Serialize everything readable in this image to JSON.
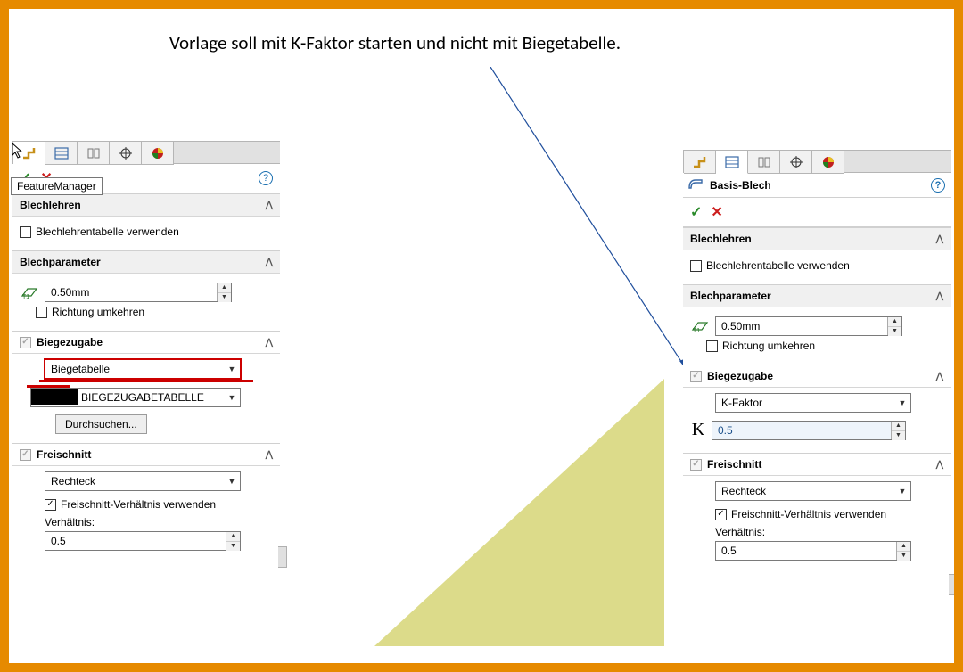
{
  "headline": "Vorlage soll mit K-Faktor starten und nicht mit Biegetabelle.",
  "tooltip": "FeatureManager",
  "left": {
    "blechlehren": {
      "title": "Blechlehren",
      "use_table": "Blechlehrentabelle verwenden"
    },
    "blechparameter": {
      "title": "Blechparameter",
      "thickness": "0.50mm",
      "reverse": "Richtung umkehren"
    },
    "biegezugabe": {
      "title": "Biegezugabe",
      "method": "Biegetabelle",
      "table": "BIEGEZUGABETABELLE",
      "browse": "Durchsuchen..."
    },
    "freischnitt": {
      "title": "Freischnitt",
      "shape": "Rechteck",
      "use_ratio": "Freischnitt-Verhältnis verwenden",
      "ratio_label": "Verhältnis:",
      "ratio": "0.5"
    }
  },
  "right": {
    "title": "Basis-Blech",
    "blechlehren": {
      "title": "Blechlehren",
      "use_table": "Blechlehrentabelle verwenden"
    },
    "blechparameter": {
      "title": "Blechparameter",
      "thickness": "0.50mm",
      "reverse": "Richtung umkehren"
    },
    "biegezugabe": {
      "title": "Biegezugabe",
      "method": "K-Faktor",
      "k_value": "0.5"
    },
    "freischnitt": {
      "title": "Freischnitt",
      "shape": "Rechteck",
      "use_ratio": "Freischnitt-Verhältnis verwenden",
      "ratio_label": "Verhältnis:",
      "ratio": "0.5"
    }
  }
}
